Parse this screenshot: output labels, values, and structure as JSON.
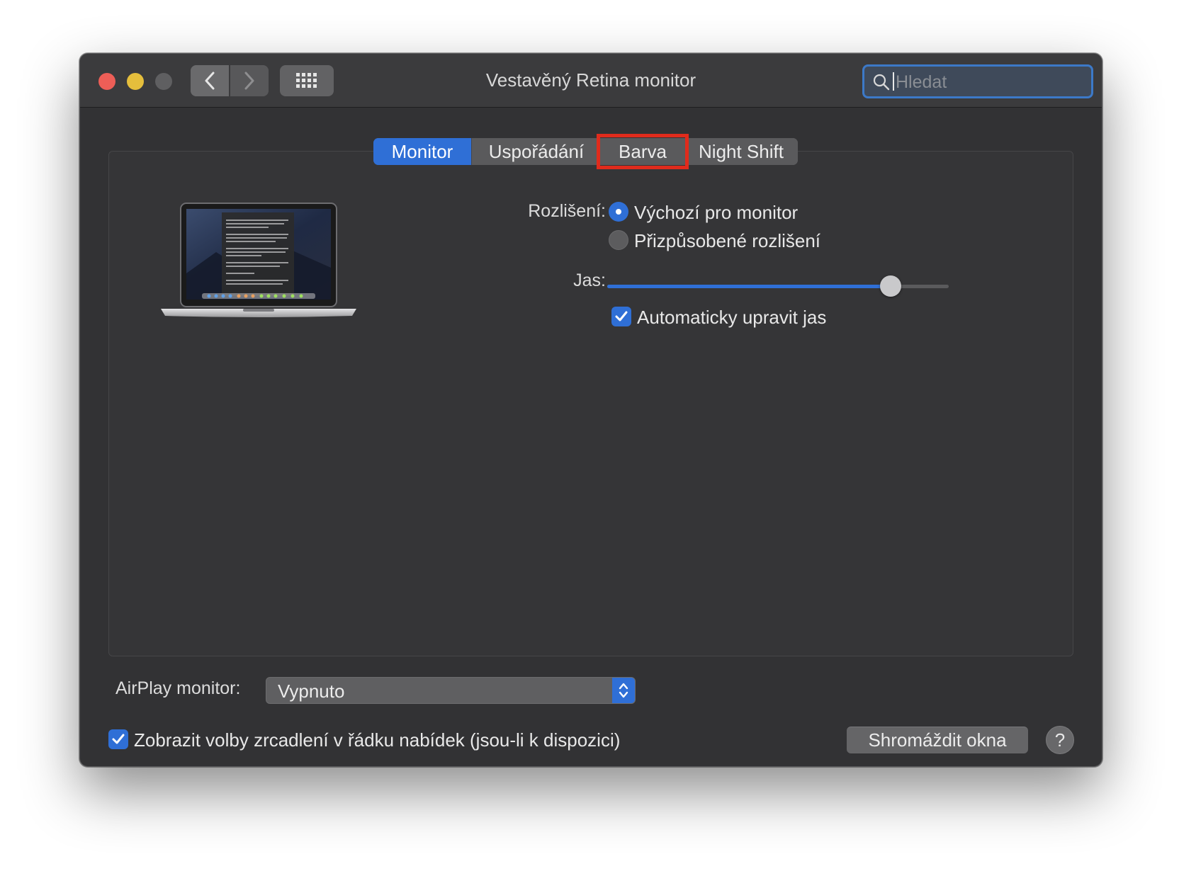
{
  "window": {
    "title": "Vestavěný Retina monitor"
  },
  "toolbar": {
    "back_icon": "chevron-left-icon",
    "forward_icon": "chevron-right-icon",
    "grid_icon": "grid-icon"
  },
  "search": {
    "placeholder": "Hledat",
    "value": ""
  },
  "tabs": [
    {
      "label": "Monitor",
      "active": true
    },
    {
      "label": "Uspořádání",
      "active": false
    },
    {
      "label": "Barva",
      "active": false,
      "highlighted": true
    },
    {
      "label": "Night Shift",
      "active": false
    }
  ],
  "display": {
    "resolution_label": "Rozlišení:",
    "resolution_options": [
      {
        "label": "Výchozí pro monitor",
        "selected": true
      },
      {
        "label": "Přizpůsobené rozlišení",
        "selected": false
      }
    ],
    "brightness_label": "Jas:",
    "brightness_value": 0.83,
    "auto_brightness_label": "Automaticky upravit jas",
    "auto_brightness_checked": true
  },
  "airplay": {
    "label": "AirPlay monitor:",
    "value": "Vypnuto"
  },
  "footer": {
    "mirroring_label": "Zobrazit volby zrcadlení v řádku nabídek (jsou-li k dispozici)",
    "mirroring_checked": true,
    "gather_button": "Shromáždit okna",
    "help_label": "?"
  },
  "colors": {
    "accent": "#2f6fd6",
    "highlight": "#e02b1c",
    "window_bg": "#323234"
  }
}
